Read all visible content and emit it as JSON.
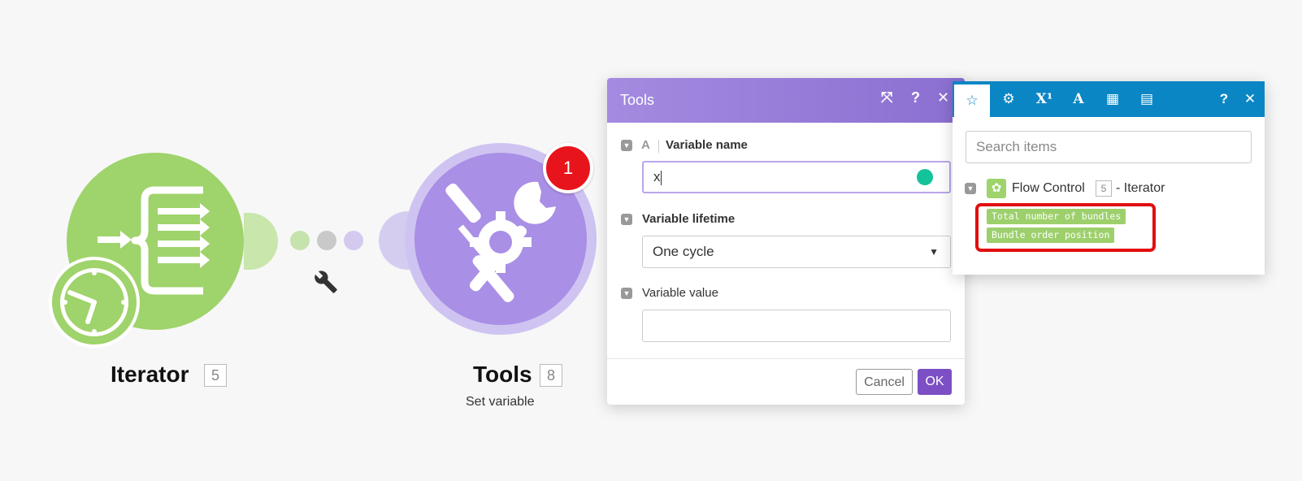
{
  "modules": {
    "iterator": {
      "label": "Iterator",
      "id": "5"
    },
    "tools": {
      "label": "Tools",
      "id": "8",
      "sublabel": "Set variable",
      "badge": "1"
    }
  },
  "dialog": {
    "title": "Tools",
    "variable_name": {
      "label": "Variable name",
      "value": "x"
    },
    "variable_lifetime": {
      "label": "Variable lifetime",
      "value": "One cycle"
    },
    "variable_value": {
      "label": "Variable value",
      "value": ""
    },
    "cancel_label": "Cancel",
    "ok_label": "OK"
  },
  "panel": {
    "tabs": [
      "star",
      "gear",
      "superscript",
      "text",
      "calendar",
      "table"
    ],
    "search_placeholder": "Search items",
    "group": {
      "name": "Flow Control",
      "id": "5",
      "suffix": "- Iterator"
    },
    "items": [
      "Total number of bundles",
      "Bundle order position"
    ]
  },
  "colors": {
    "iterator_green": "#9fd36b",
    "tools_purple": "#a98fe6",
    "dialog_header": "#9a7fd9",
    "panel_blue": "#0b86c4",
    "ok_button": "#7c4fc4",
    "badge_red": "#e8141c",
    "highlight_red": "#e20e0e"
  }
}
